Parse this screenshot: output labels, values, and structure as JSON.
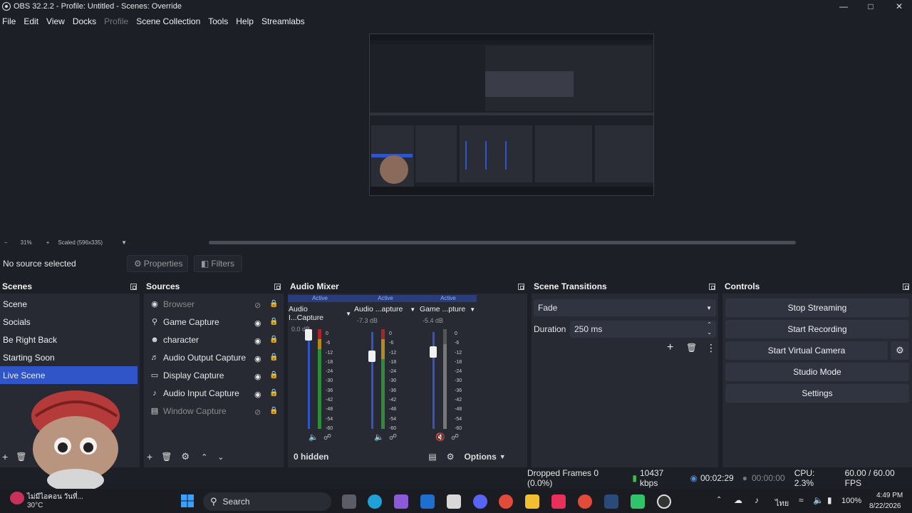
{
  "window": {
    "title": "OBS 32.2.2 - Profile: Untitled - Scenes: Override"
  },
  "menu": [
    "File",
    "Edit",
    "View",
    "Docks",
    "Profile",
    "Scene Collection",
    "Tools",
    "Help",
    "Streamlabs"
  ],
  "preview": {
    "zoom": "31%",
    "scale_mode": "Scaled (596x335)"
  },
  "source_bar": {
    "status": "No source selected",
    "properties": "Properties",
    "filters": "Filters"
  },
  "scenes": {
    "title": "Scenes",
    "items": [
      "Scene",
      "Socials",
      "Be Right Back",
      "Starting Soon",
      "Live Scene"
    ],
    "selected": "Live Scene"
  },
  "sources": {
    "title": "Sources",
    "items": [
      {
        "name": "Browser",
        "icon": "globe-icon",
        "visible": false
      },
      {
        "name": "Game Capture",
        "icon": "gamepad-icon",
        "visible": true
      },
      {
        "name": "character",
        "icon": "user-icon",
        "visible": true
      },
      {
        "name": "Audio Output Capture",
        "icon": "speaker-icon",
        "visible": true
      },
      {
        "name": "Display Capture",
        "icon": "monitor-icon",
        "visible": true
      },
      {
        "name": "Audio Input Capture",
        "icon": "mic-icon",
        "visible": true
      },
      {
        "name": "Window Capture",
        "icon": "window-icon",
        "visible": false
      }
    ]
  },
  "mixer": {
    "title": "Audio Mixer",
    "channels": [
      {
        "name": "Audio I...Capture",
        "db": "0.0 dB",
        "active": "Active",
        "level": 1.0,
        "muted": false
      },
      {
        "name": "Audio ...apture",
        "db": "-7.3 dB",
        "active": "Active",
        "level": 0.78,
        "muted": false
      },
      {
        "name": "Game ...pture",
        "db": "-5.4 dB",
        "active": "Active",
        "level": 0.82,
        "muted": true
      }
    ],
    "ticks": [
      "0",
      "-6",
      "-12",
      "-18",
      "-24",
      "-30",
      "-36",
      "-42",
      "-48",
      "-54",
      "-60"
    ],
    "hidden": "0 hidden",
    "options": "Options"
  },
  "transitions": {
    "title": "Scene Transitions",
    "selected": "Fade",
    "duration_label": "Duration",
    "duration": "250 ms"
  },
  "controls": {
    "title": "Controls",
    "buttons": [
      "Stop Streaming",
      "Start Recording",
      "Start Virtual Camera",
      "Studio Mode",
      "Settings"
    ]
  },
  "status": {
    "dropped": "Dropped Frames 0 (0.0%)",
    "bitrate": "10437 kbps",
    "stream_time": "00:02:29",
    "rec_time": "00:00:00",
    "cpu": "CPU: 2.3%",
    "fps": "60.00 / 60.00 FPS"
  },
  "taskbar": {
    "weather_label": "ไม่มีไอคอน วันที่...",
    "temp": "30°C",
    "search": "Search",
    "lang": "ไทย",
    "battery": "100%",
    "time": "4:49 PM",
    "date": "8/22/2026"
  },
  "colors": {
    "accent": "#2f55c8",
    "bg": "#1d1f26",
    "dock": "#272a33"
  }
}
